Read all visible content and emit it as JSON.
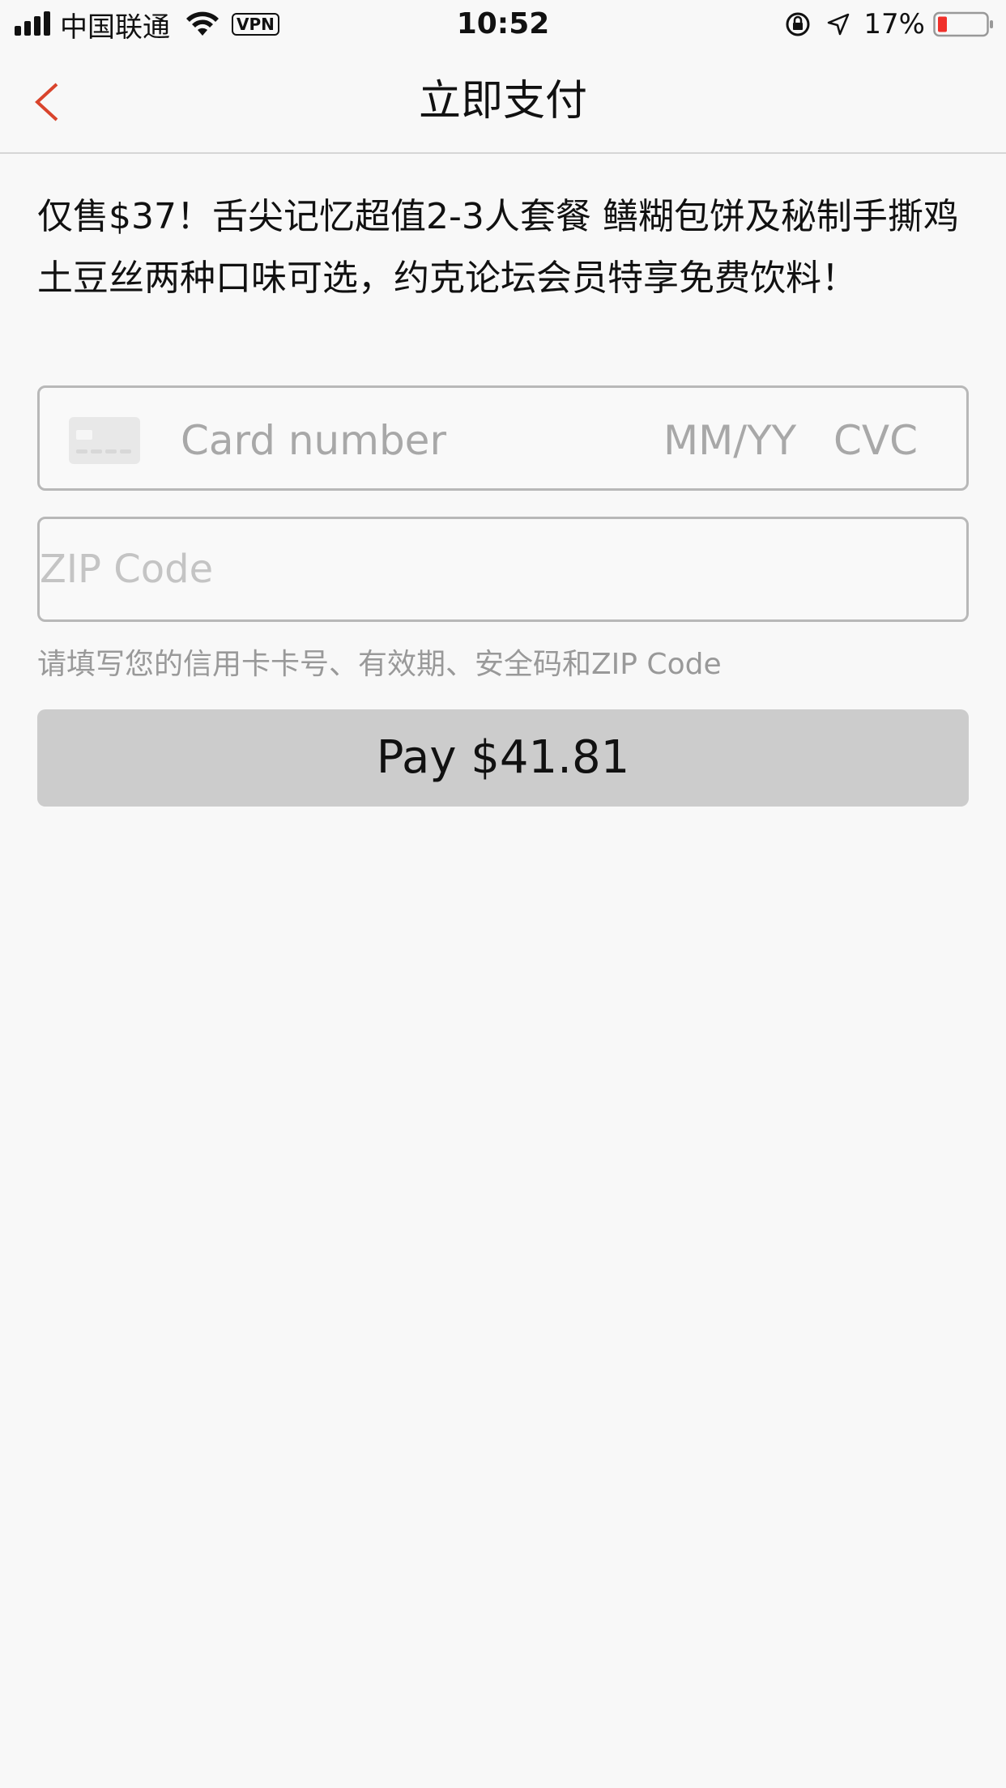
{
  "status_bar": {
    "carrier": "中国联通",
    "vpn": "VPN",
    "time": "10:52",
    "battery": "17%"
  },
  "nav": {
    "title": "立即支付"
  },
  "product": {
    "description": "仅售$37！舌尖记忆超值2-3人套餐 鳝糊包饼及秘制手撕鸡 土豆丝两种口味可选，约克论坛会员特享免费饮料！"
  },
  "card_form": {
    "card_number_placeholder": "Card number",
    "expiry_placeholder": "MM/YY",
    "cvc_placeholder": "CVC",
    "zip_placeholder": "ZIP Code",
    "hint": "请填写您的信用卡卡号、有效期、安全码和ZIP Code"
  },
  "pay_button": {
    "label": "Pay $41.81"
  },
  "colors": {
    "accent_back": "#d9442c",
    "button_bg": "#cccccc",
    "battery_low": "#f0302a"
  }
}
